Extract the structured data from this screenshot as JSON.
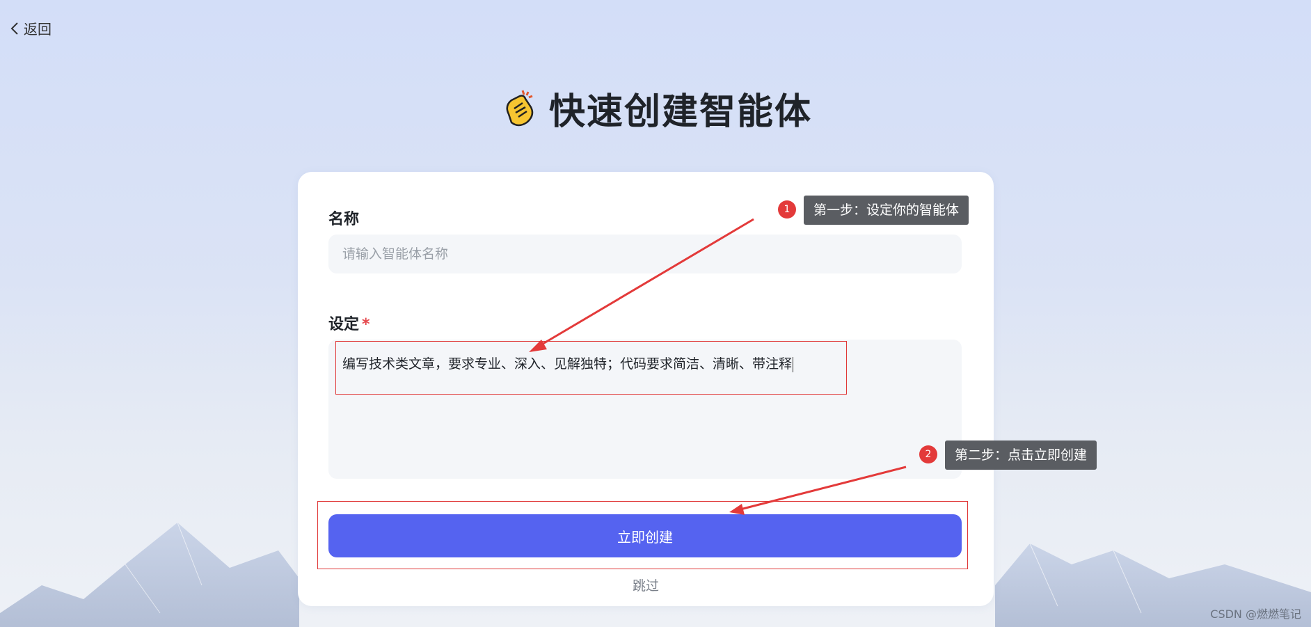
{
  "nav": {
    "back_label": "返回"
  },
  "header": {
    "title": "快速创建智能体",
    "icon": "clapping-hands-icon"
  },
  "form": {
    "name_label": "名称",
    "name_placeholder": "请输入智能体名称",
    "name_value": "",
    "setting_label": "设定",
    "setting_required_mark": "*",
    "setting_value": "编写技术类文章，要求专业、深入、见解独特；代码要求简洁、清晰、带注释",
    "create_button_label": "立即创建",
    "skip_label": "跳过"
  },
  "annotations": {
    "step1_number": "1",
    "step1_text": "第一步：设定你的智能体",
    "step2_number": "2",
    "step2_text": "第二步：点击立即创建"
  },
  "watermark": "CSDN @燃燃笔记",
  "colors": {
    "primary_button": "#5563f0",
    "annotation_red": "#e33a3a",
    "tooltip_bg": "#5a5d62",
    "input_bg": "#f4f6f9"
  }
}
